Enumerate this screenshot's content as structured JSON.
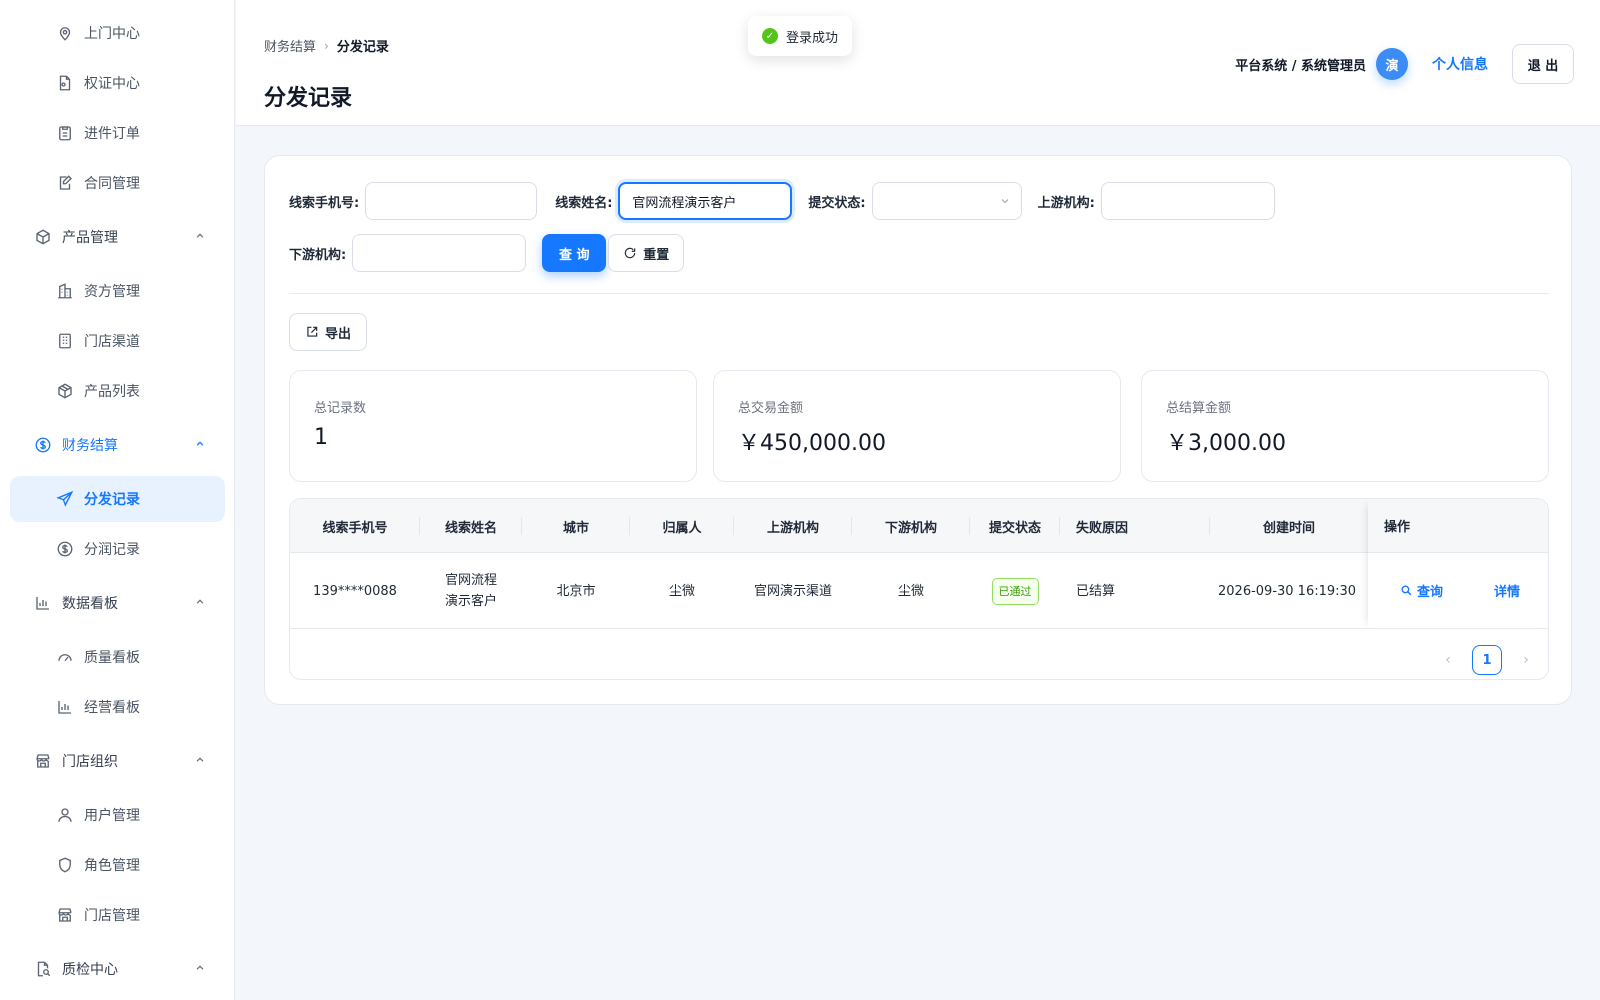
{
  "sidebar": {
    "items": [
      {
        "label": "上门中心",
        "icon": "location-icon"
      },
      {
        "label": "权证中心",
        "icon": "document-icon"
      },
      {
        "label": "进件订单",
        "icon": "clipboard-icon"
      },
      {
        "label": "合同管理",
        "icon": "edit-doc-icon"
      },
      {
        "label": "产品管理",
        "icon": "cube-icon"
      },
      {
        "label": "资方管理",
        "icon": "building-icon"
      },
      {
        "label": "门店渠道",
        "icon": "store-grid-icon"
      },
      {
        "label": "产品列表",
        "icon": "box-icon"
      },
      {
        "label": "财务结算",
        "icon": "dollar-icon"
      },
      {
        "label": "分发记录",
        "icon": "send-icon"
      },
      {
        "label": "分润记录",
        "icon": "dollar-circle-icon"
      },
      {
        "label": "数据看板",
        "icon": "bar-chart-icon"
      },
      {
        "label": "质量看板",
        "icon": "gauge-icon"
      },
      {
        "label": "经营看板",
        "icon": "bar-chart-icon"
      },
      {
        "label": "门店组织",
        "icon": "shop-icon"
      },
      {
        "label": "用户管理",
        "icon": "user-icon"
      },
      {
        "label": "角色管理",
        "icon": "shield-icon"
      },
      {
        "label": "门店管理",
        "icon": "shop-icon"
      },
      {
        "label": "质检中心",
        "icon": "doc-search-icon"
      }
    ]
  },
  "header": {
    "breadcrumb": [
      "财务结算",
      "分发记录"
    ],
    "breadcrumb_sep": "›",
    "title": "分发记录",
    "user": "平台系统 / 系统管理员",
    "avatar": "演",
    "profile_link": "个人信息",
    "logout": "退 出"
  },
  "toast": {
    "text": "登录成功",
    "check": "✓"
  },
  "filters": {
    "phone_label": "线索手机号:",
    "phone_value": "",
    "name_label": "线索姓名:",
    "name_value": "官网流程演示客户",
    "status_label": "提交状态:",
    "upstream_label": "上游机构:",
    "downstream_label": "下游机构:",
    "query_button": "查 询",
    "reset_button": "重置"
  },
  "toolbar": {
    "export_button": "导出"
  },
  "stats": [
    {
      "label": "总记录数",
      "value": "1"
    },
    {
      "label": "总交易金额",
      "value": "￥450,000.00"
    },
    {
      "label": "总结算金额",
      "value": "￥3,000.00"
    }
  ],
  "table": {
    "headers": [
      "线索手机号",
      "线索姓名",
      "城市",
      "归属人",
      "上游机构",
      "下游机构",
      "提交状态",
      "失败原因",
      "创建时间",
      "操作"
    ],
    "rows": [
      {
        "phone": "139****0088",
        "name_line1": "官网流程",
        "name_line2": "演示客户",
        "city": "北京市",
        "owner": "尘微",
        "upstream": "官网演示渠道",
        "downstream": "尘微",
        "status": "已通过",
        "fail_reason": "已结算",
        "created": "2026-09-30 16:19:30",
        "op_query": "查询",
        "op_detail": "详情"
      }
    ]
  },
  "pagination": {
    "current": "1",
    "prev": "‹",
    "next": "›"
  },
  "colors": {
    "accent": "#1677ff",
    "success": "#52c41a"
  }
}
